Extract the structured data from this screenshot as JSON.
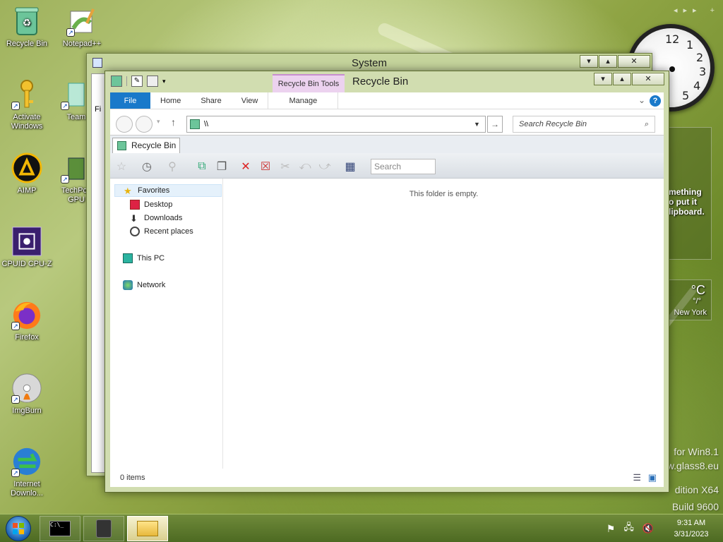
{
  "desktop_icons": [
    {
      "label": "Recycle Bin"
    },
    {
      "label": "Notepad++"
    },
    {
      "label": "Activate Windows"
    },
    {
      "label": "Team"
    },
    {
      "label": "AIMP"
    },
    {
      "label": "TechPov GPU"
    },
    {
      "label": "CPUID CPU-Z"
    },
    {
      "label": "Firefox"
    },
    {
      "label": "ImgBurn"
    },
    {
      "label": "Internet Downlo..."
    }
  ],
  "gadgets": {
    "clipboard_text": "mething\no put it\nlipboard.",
    "weather_unit": "°C",
    "weather_range": "°/°",
    "weather_city": "New York",
    "watermark_line1": "for Win8.1",
    "watermark_line2": "w.glass8.eu",
    "watermark_line3": "dition X64",
    "watermark_line4": "Build 9600"
  },
  "clock_numbers": [
    "12",
    "1",
    "2",
    "3",
    "4",
    "5"
  ],
  "back_window": {
    "title": "System",
    "sidebar_fragment": "Fi"
  },
  "front_window": {
    "title": "Recycle Bin",
    "context_tab": "Recycle Bin Tools",
    "ribbon_tabs": {
      "file": "File",
      "home": "Home",
      "share": "Share",
      "view": "View",
      "manage": "Manage"
    },
    "address": "\\\\",
    "search_placeholder": "Search Recycle Bin",
    "doc_tab": "Recycle Bin",
    "toolbar_search_placeholder": "Search",
    "nav": {
      "favorites": "Favorites",
      "desktop": "Desktop",
      "downloads": "Downloads",
      "recent": "Recent places",
      "this_pc": "This PC",
      "network": "Network"
    },
    "empty_message": "This folder is empty.",
    "status_items": "0 items"
  },
  "taskbar": {
    "time": "9:31 AM",
    "date": "3/31/2023"
  }
}
